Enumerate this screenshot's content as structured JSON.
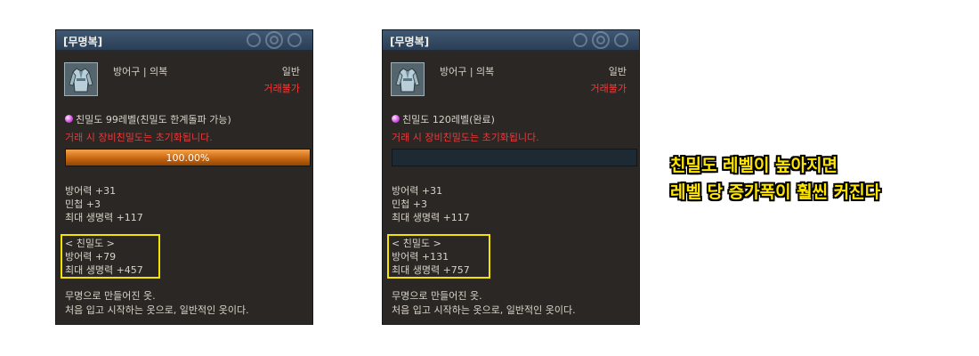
{
  "panels": [
    {
      "title": "[무명복]",
      "category": "방어구 | 의복",
      "grade": "일반",
      "trade": "거래불가",
      "gem_icon": "pink-gem-icon",
      "level_text": "친밀도 99레벨(친밀도 한계돌파 가능)",
      "warning": "거래 시 장비친밀도는 초기화됩니다.",
      "progress_text": "100.00%",
      "progress": 1.0,
      "stats": [
        "방어력 +31",
        "민첩 +3",
        "최대 생명력 +117"
      ],
      "bonus": [
        "< 친밀도 >",
        "방어력 +79",
        "최대 생명력 +457"
      ],
      "desc": [
        "무명으로 만들어진 옷.",
        "처음 입고 시작하는 옷으로, 일반적인 옷이다."
      ]
    },
    {
      "title": "[무명복]",
      "category": "방어구 | 의복",
      "grade": "일반",
      "trade": "거래불가",
      "gem_icon": "pink-gem-icon",
      "level_text": "친밀도 120레벨(완료)",
      "warning": "거래 시 장비친밀도는 초기화됩니다.",
      "progress_text": "",
      "progress": 0,
      "stats": [
        "방어력 +31",
        "민첩 +3",
        "최대 생명력 +117"
      ],
      "bonus": [
        "< 친밀도 >",
        "방어력 +131",
        "최대 생명력 +757"
      ],
      "desc": [
        "무명으로 만들어진 옷.",
        "처음 입고 시작하는 옷으로, 일반적인 옷이다."
      ]
    }
  ],
  "caption": {
    "line1": "친밀도 레벨이 높아지면",
    "line2": "레벨 당 증가폭이 훨씬 커진다"
  },
  "colors": {
    "panel_bg": "#2b2724",
    "title_bg": "#3a5068",
    "warning": "#e83a3a",
    "highlight_box": "#f4e300",
    "caption": "#ffe600"
  }
}
